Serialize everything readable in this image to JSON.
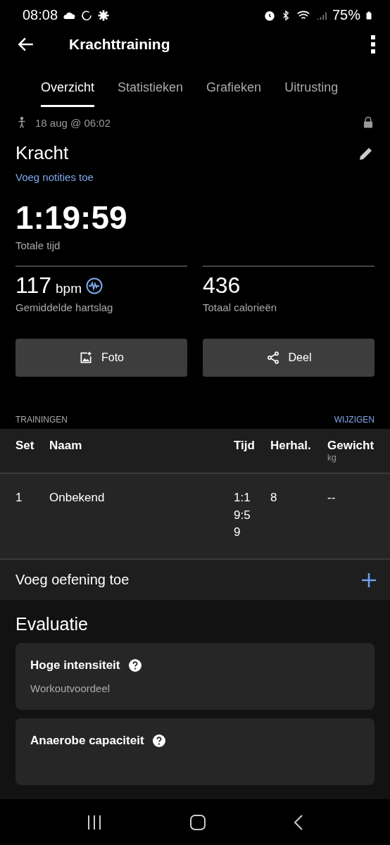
{
  "status_bar": {
    "time": "08:08",
    "battery": "75%"
  },
  "app_bar": {
    "title": "Krachttraining"
  },
  "tabs": [
    {
      "label": "Overzicht",
      "selected": true
    },
    {
      "label": "Statistieken",
      "selected": false
    },
    {
      "label": "Grafieken",
      "selected": false
    },
    {
      "label": "Uitrusting",
      "selected": false
    }
  ],
  "activity": {
    "date": "18 aug @ 06:02",
    "name": "Kracht",
    "notes_link": "Voeg notities toe",
    "total_time": "1:19:59",
    "total_time_label": "Totale tijd"
  },
  "stats": [
    {
      "value": "117",
      "unit": "bpm",
      "label": "Gemiddelde hartslag",
      "kind": "heart_rate"
    },
    {
      "value": "436",
      "label": "Totaal calorieën",
      "kind": "calories"
    }
  ],
  "actions": [
    {
      "kind": "photo",
      "label": "Foto"
    },
    {
      "kind": "share",
      "label": "Deel"
    }
  ],
  "trainings": {
    "title": "TRAININGEN",
    "edit": "WIJZIGEN",
    "columns": [
      {
        "label": "Set"
      },
      {
        "label": "Naam"
      },
      {
        "label": "Tijd"
      },
      {
        "label": "Herhal."
      },
      {
        "label": "Gewicht",
        "unit": "kg"
      }
    ],
    "rows": [
      [
        "1",
        "Onbekend",
        "1:19:59",
        "8",
        "--"
      ]
    ],
    "add": "Voeg oefening toe"
  },
  "evaluation": {
    "title": "Evaluatie",
    "cards": [
      {
        "title": "Hoge intensiteit",
        "subtitle": "Workoutvoordeel"
      },
      {
        "title": "Anaerobe capaciteit"
      }
    ]
  }
}
